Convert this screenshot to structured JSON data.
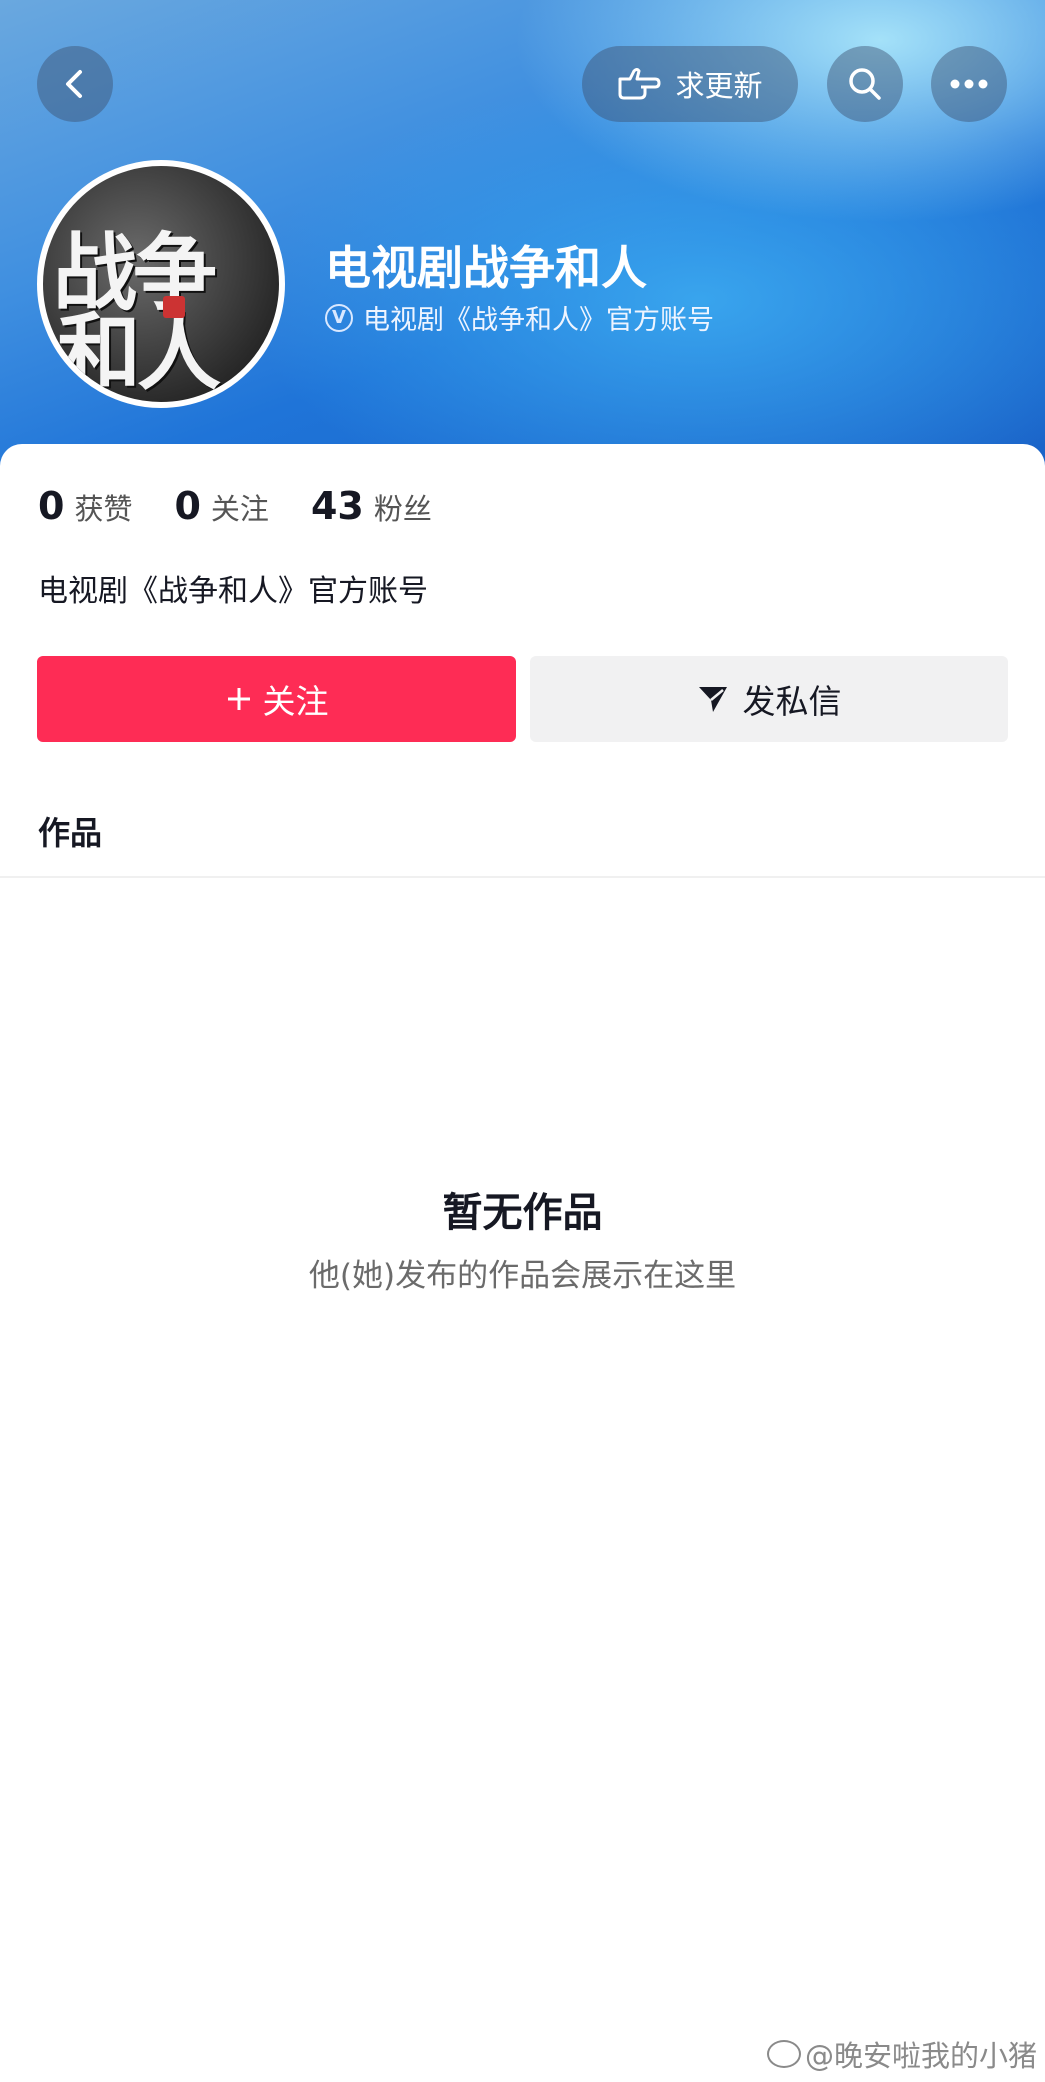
{
  "header": {
    "back_icon": "chevron-left-icon",
    "update_button_label": "求更新",
    "update_icon": "pointing-hand-icon",
    "search_icon": "search-icon",
    "more_icon": "more-dots-icon"
  },
  "profile": {
    "avatar_lines": [
      "战争",
      "和人"
    ],
    "name": "电视剧战争和人",
    "verified_icon": "verified-badge-icon",
    "verified_badge_text": "V",
    "verified_text": "电视剧《战争和人》官方账号"
  },
  "stats": [
    {
      "value": "0",
      "label": "获赞"
    },
    {
      "value": "0",
      "label": "关注"
    },
    {
      "value": "43",
      "label": "粉丝"
    }
  ],
  "bio": "电视剧《战争和人》官方账号",
  "actions": {
    "follow_label": "关注",
    "follow_icon": "plus-icon",
    "message_label": "发私信",
    "message_icon": "send-plane-icon"
  },
  "tabs": {
    "works": "作品"
  },
  "empty_state": {
    "title": "暂无作品",
    "subtitle": "他(她)发布的作品会展示在这里"
  },
  "watermark": "@晚安啦我的小猪",
  "colors": {
    "accent": "#fe2c55",
    "header_blue": "#1f74d8",
    "secondary_button": "#f1f1f2"
  }
}
